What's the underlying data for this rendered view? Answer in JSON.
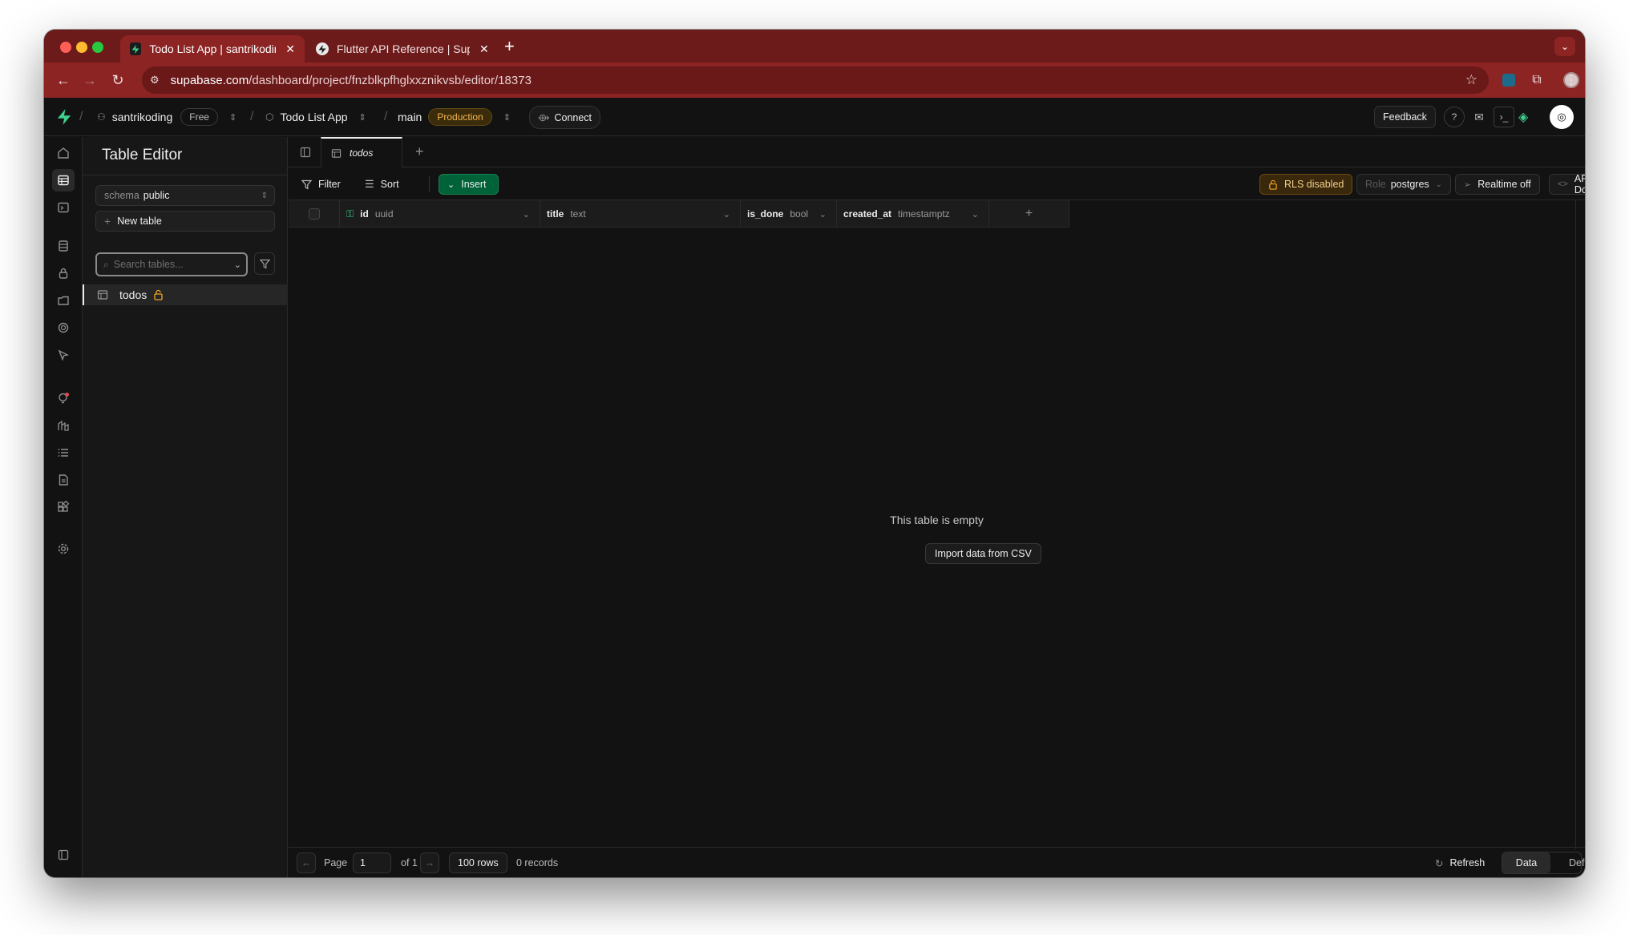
{
  "browser": {
    "tabs": [
      {
        "title": "Todo List App | santrikoding |",
        "active": true
      },
      {
        "title": "Flutter API Reference | Supab",
        "active": false
      }
    ],
    "url_domain": "supabase.com",
    "url_path": "/dashboard/project/fnzblkpfhglxxznikvsb/editor/18373"
  },
  "header": {
    "org": "santrikoding",
    "plan": "Free",
    "project": "Todo List App",
    "branch": "main",
    "env": "Production",
    "connect": "Connect",
    "feedback": "Feedback"
  },
  "panel": {
    "title": "Table Editor",
    "schema_label": "schema",
    "schema_value": "public",
    "new_table": "New table",
    "search_placeholder": "Search tables...",
    "tables": [
      {
        "name": "todos",
        "locked": true
      }
    ]
  },
  "editor": {
    "tab": "todos",
    "filter": "Filter",
    "sort": "Sort",
    "insert": "Insert",
    "rls": "RLS disabled",
    "role_label": "Role",
    "role_value": "postgres",
    "realtime": "Realtime off",
    "api_docs": "API Docs",
    "columns": [
      {
        "name": "id",
        "type": "uuid",
        "primary": true
      },
      {
        "name": "title",
        "type": "text"
      },
      {
        "name": "is_done",
        "type": "bool"
      },
      {
        "name": "created_at",
        "type": "timestamptz"
      }
    ],
    "empty_message": "This table is empty",
    "import_csv": "Import data from CSV"
  },
  "footer": {
    "page_label": "Page",
    "page_value": "1",
    "of_pages": "of 1",
    "rows": "100 rows",
    "records": "0 records",
    "refresh": "Refresh",
    "view_data": "Data",
    "view_definition": "Definition"
  },
  "colors": {
    "brand": "#3ecf8e",
    "browser_frame": "#8c2424",
    "insert": "#006239",
    "warning": "#f5b54c"
  }
}
